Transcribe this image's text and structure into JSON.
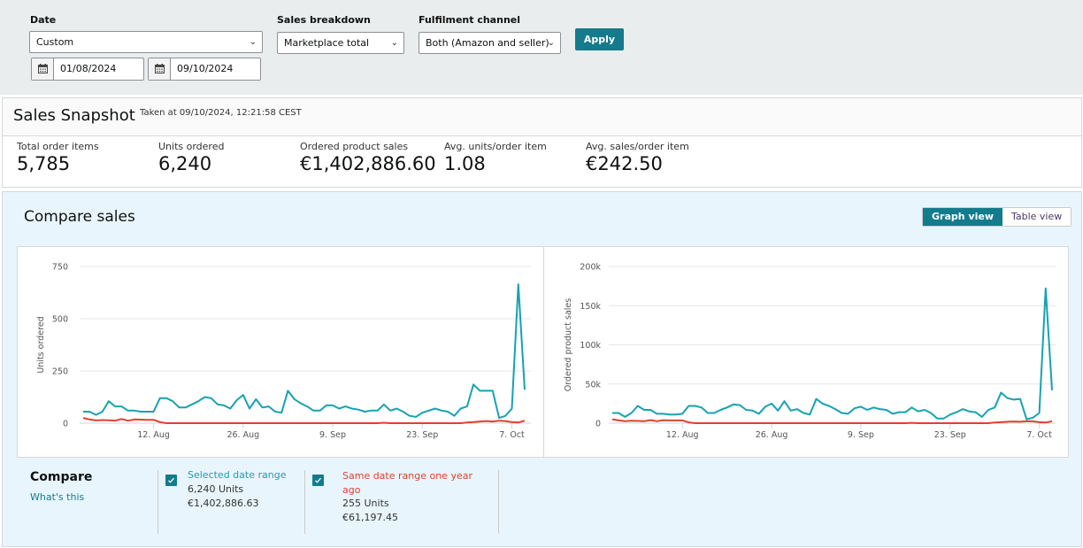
{
  "filters": {
    "date_label": "Date",
    "date_select": "Custom",
    "start_date": "01/08/2024",
    "end_date": "09/10/2024",
    "sales_breakdown_label": "Sales breakdown",
    "sales_breakdown_select": "Marketplace total",
    "fulfilment_label": "Fulfilment channel",
    "fulfilment_select": "Both (Amazon and seller)",
    "apply_label": "Apply"
  },
  "snapshot": {
    "title": "Sales Snapshot",
    "taken_at": "Taken at 09/10/2024, 12:21:58 CEST",
    "metrics": [
      {
        "label": "Total order items",
        "value": "5,785"
      },
      {
        "label": "Units ordered",
        "value": "6,240"
      },
      {
        "label": "Ordered product sales",
        "value": "€1,402,886.60"
      },
      {
        "label": "Avg. units/order item",
        "value": "1.08"
      },
      {
        "label": "Avg. sales/order item",
        "value": "€242.50"
      }
    ]
  },
  "compare": {
    "title": "Compare sales",
    "graph_view_label": "Graph view",
    "table_view_label": "Table view",
    "legend_title": "Compare",
    "whats_this": "What's this",
    "series": [
      {
        "name": "Selected date range",
        "units": "6,240 Units",
        "sales": "€1,402,886.63",
        "color": "#17a2b0",
        "checked": true
      },
      {
        "name": "Same date range one year ago",
        "units": "255 Units",
        "sales": "€61,197.45",
        "color": "#e3402a",
        "checked": true
      }
    ]
  },
  "colors": {
    "accent": "#137b8c",
    "current_series": "#17a2b0",
    "previous_series": "#e3402a"
  },
  "chart_data": [
    {
      "type": "line",
      "title": "",
      "xlabel": "",
      "ylabel": "Units ordered",
      "ylim": [
        0,
        750
      ],
      "yticks": [
        "0",
        "250",
        "500",
        "750"
      ],
      "ytick_values": [
        0,
        250,
        500,
        750
      ],
      "xticks": [
        "12. Aug",
        "26. Aug",
        "9. Sep",
        "23. Sep",
        "7. Oct"
      ],
      "xtick_day_index": [
        11,
        25,
        39,
        53,
        67
      ],
      "x_start": "1 Aug 2024",
      "x_count": 70,
      "grid": true,
      "series": [
        {
          "name": "Selected date range",
          "color": "#17a2b0",
          "values": [
            55,
            55,
            40,
            55,
            105,
            80,
            80,
            60,
            60,
            55,
            55,
            55,
            120,
            120,
            105,
            75,
            75,
            90,
            105,
            125,
            120,
            90,
            85,
            70,
            110,
            135,
            70,
            115,
            75,
            80,
            55,
            50,
            155,
            115,
            95,
            80,
            60,
            60,
            85,
            85,
            70,
            80,
            70,
            65,
            55,
            60,
            60,
            90,
            60,
            70,
            55,
            35,
            30,
            50,
            60,
            70,
            60,
            55,
            35,
            70,
            80,
            185,
            155,
            155,
            155,
            25,
            35,
            70,
            665,
            160
          ]
        },
        {
          "name": "Same date range one year ago",
          "color": "#e3402a",
          "values": [
            25,
            18,
            13,
            15,
            14,
            12,
            20,
            12,
            18,
            17,
            16,
            16,
            5,
            0,
            0,
            0,
            0,
            0,
            0,
            0,
            0,
            0,
            0,
            0,
            0,
            0,
            0,
            0,
            0,
            0,
            0,
            0,
            0,
            0,
            0,
            0,
            0,
            0,
            0,
            0,
            0,
            0,
            0,
            0,
            0,
            0,
            0,
            2,
            0,
            0,
            0,
            0,
            0,
            0,
            0,
            0,
            0,
            0,
            0,
            0,
            3,
            5,
            8,
            10,
            8,
            12,
            10,
            5,
            3,
            12
          ]
        }
      ]
    },
    {
      "type": "line",
      "title": "",
      "xlabel": "",
      "ylabel": "Ordered product sales",
      "ylim": [
        0,
        200000
      ],
      "yticks": [
        "0",
        "50k",
        "100k",
        "150k",
        "200k"
      ],
      "ytick_values": [
        0,
        50000,
        100000,
        150000,
        200000
      ],
      "xticks": [
        "12. Aug",
        "26. Aug",
        "9. Sep",
        "23. Sep",
        "7. Oct"
      ],
      "xtick_day_index": [
        11,
        25,
        39,
        53,
        67
      ],
      "x_start": "1 Aug 2024",
      "x_count": 70,
      "grid": true,
      "series": [
        {
          "name": "Selected date range",
          "color": "#17a2b0",
          "values": [
            13000,
            13000,
            8000,
            13000,
            22000,
            17000,
            17000,
            12000,
            12000,
            11000,
            11000,
            12000,
            22000,
            22000,
            20000,
            13000,
            13000,
            17000,
            20000,
            24000,
            23000,
            17000,
            16000,
            12000,
            21000,
            25000,
            16000,
            28000,
            16000,
            18000,
            13000,
            11000,
            31000,
            25000,
            22000,
            18000,
            13000,
            12000,
            19000,
            21000,
            17000,
            20000,
            18000,
            17000,
            12000,
            14000,
            14000,
            20000,
            15000,
            17000,
            13000,
            6000,
            6000,
            11000,
            14000,
            18000,
            15000,
            14000,
            8000,
            17000,
            20000,
            39000,
            32000,
            30000,
            31000,
            5000,
            7000,
            13000,
            172000,
            42000
          ]
        },
        {
          "name": "Same date range one year ago",
          "color": "#e3402a",
          "values": [
            5000,
            3500,
            2500,
            3000,
            2800,
            2500,
            4000,
            2500,
            3800,
            3500,
            3500,
            3500,
            1000,
            0,
            0,
            0,
            0,
            0,
            0,
            0,
            0,
            0,
            0,
            0,
            0,
            0,
            0,
            0,
            0,
            0,
            0,
            0,
            0,
            0,
            0,
            0,
            0,
            0,
            0,
            0,
            0,
            0,
            0,
            0,
            0,
            0,
            0,
            500,
            0,
            0,
            0,
            0,
            0,
            0,
            0,
            0,
            0,
            0,
            0,
            0,
            800,
            1200,
            1800,
            2200,
            1800,
            2600,
            2400,
            1200,
            800,
            2500
          ]
        }
      ]
    }
  ]
}
